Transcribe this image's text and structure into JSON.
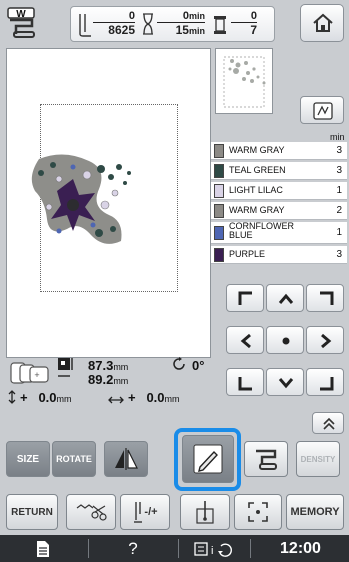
{
  "status": {
    "stitch_current": "0",
    "stitch_total": "8625",
    "time_current": "0",
    "time_total": "15",
    "time_unit": "min",
    "color_current": "0",
    "color_total": "7"
  },
  "color_list": {
    "min_label": "min",
    "items": [
      {
        "name": "WARM GRAY",
        "minutes": "3",
        "color": "#8c8a86"
      },
      {
        "name": "TEAL GREEN",
        "minutes": "3",
        "color": "#2f4a46"
      },
      {
        "name": "LIGHT LILAC",
        "minutes": "1",
        "color": "#d9d3e6"
      },
      {
        "name": "WARM GRAY",
        "minutes": "2",
        "color": "#8c8a86"
      },
      {
        "name": "CORNFLOWER BLUE",
        "minutes": "1",
        "color": "#4e66b3"
      },
      {
        "name": "PURPLE",
        "minutes": "3",
        "color": "#3a1f52"
      }
    ]
  },
  "info": {
    "width_value": "87.3",
    "height_value": "89.2",
    "size_unit": "mm",
    "angle_value": "0°",
    "move_y_prefix": "+",
    "move_y_value": "0.0",
    "move_x_prefix": "+",
    "move_x_value": "0.0",
    "move_unit": "mm"
  },
  "toolbar": {
    "size_label": "SIZE",
    "rotate_label": "ROTATE",
    "density_label": "DENSITY",
    "return_label": "RETURN",
    "memory_label": "MEMORY",
    "minus_plus_label": "-/+"
  },
  "footer": {
    "help_label": "?",
    "clock": "12:00"
  },
  "colors": {
    "highlight": "#1a8ce8",
    "background": "#c9ccd0",
    "bottom_bar": "#2c2f33"
  }
}
